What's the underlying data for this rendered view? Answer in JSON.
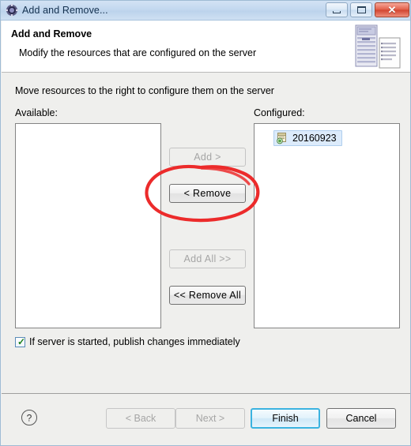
{
  "window": {
    "title": "Add and Remove...",
    "icon": "gear-icon",
    "controls": {
      "minimize": "minimize-icon",
      "maximize": "maximize-icon",
      "close": "✕"
    }
  },
  "header": {
    "title": "Add and Remove",
    "description": "Modify the resources that are configured on the server",
    "banner_icon": "server-and-document-icon"
  },
  "main": {
    "instruction": "Move resources to the right to configure them on the server",
    "available": {
      "label": "Available:",
      "items": []
    },
    "configured": {
      "label": "Configured:",
      "items": [
        {
          "name": "20160923",
          "icon": "web-module-icon",
          "selected": true
        }
      ]
    },
    "transfer_buttons": [
      {
        "label": "Add >",
        "enabled": false
      },
      {
        "label": "< Remove",
        "enabled": true
      },
      {
        "label": "Add All >>",
        "enabled": false
      },
      {
        "label": "<< Remove All",
        "enabled": true
      }
    ],
    "publish_checkbox": {
      "label": "If server is started, publish changes immediately",
      "checked": true
    }
  },
  "footer": {
    "help": "?",
    "buttons": [
      {
        "label": "< Back",
        "enabled": false,
        "default": false
      },
      {
        "label": "Next >",
        "enabled": false,
        "default": false
      },
      {
        "label": "Finish",
        "enabled": true,
        "default": true
      },
      {
        "label": "Cancel",
        "enabled": true,
        "default": false
      }
    ]
  },
  "annotation": {
    "shape": "ellipse",
    "color": "#ec2b2b",
    "target": "< Remove"
  },
  "colors": {
    "titlebar_top": "#d3e3f4",
    "titlebar_bottom": "#cfe0f2",
    "body_bg": "#efefed",
    "header_bg": "#ffffff",
    "selection_bg": "#dcebfb",
    "default_button_border": "#3bb3e0",
    "annotation_red": "#ec2b2b"
  }
}
